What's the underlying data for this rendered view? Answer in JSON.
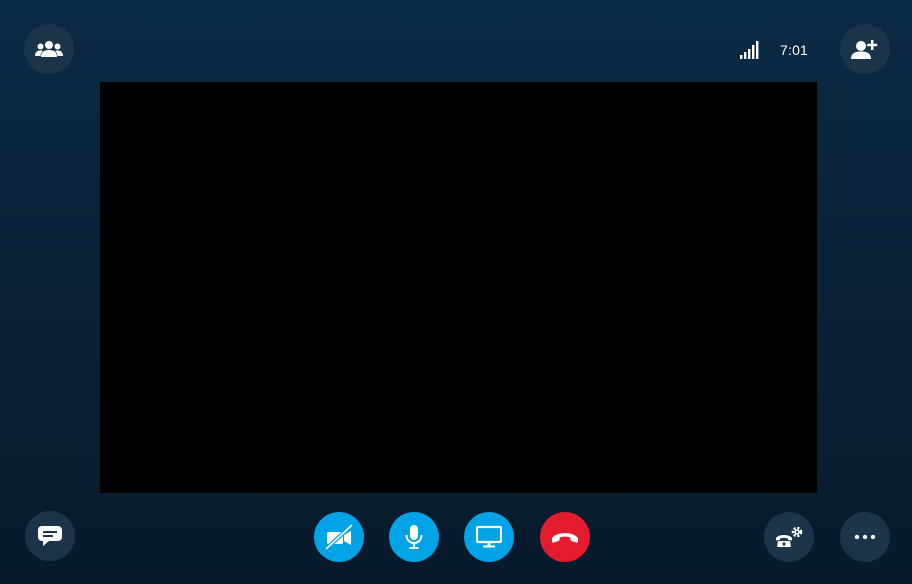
{
  "window": {
    "type": "video-call"
  },
  "status": {
    "time": "7:01",
    "signal_icon": "signal-strength-icon",
    "signal_level": 5
  },
  "top_bar": {
    "left_button": {
      "icon": "participants-icon"
    },
    "right_button": {
      "icon": "add-person-icon"
    }
  },
  "video_area": {
    "background": "#000000"
  },
  "call_controls": [
    {
      "id": "video",
      "icon": "video-off-icon",
      "color": "#00a3e6",
      "state": "off"
    },
    {
      "id": "mic",
      "icon": "microphone-icon",
      "color": "#00a3e6",
      "state": "on"
    },
    {
      "id": "screen",
      "icon": "screen-share-icon",
      "color": "#00a3e6"
    },
    {
      "id": "hangup",
      "icon": "end-call-icon",
      "color": "#e41b2f"
    }
  ],
  "bottom_bar": {
    "left_button": {
      "icon": "chat-icon"
    },
    "right_buttons": [
      {
        "icon": "call-settings-icon"
      },
      {
        "icon": "more-options-icon"
      }
    ]
  },
  "colors": {
    "background_top": "#0b2a45",
    "background_bottom": "#081a2c",
    "accent_blue": "#00a3e6",
    "hangup_red": "#e41b2f",
    "dark_button": "#1c3449"
  }
}
